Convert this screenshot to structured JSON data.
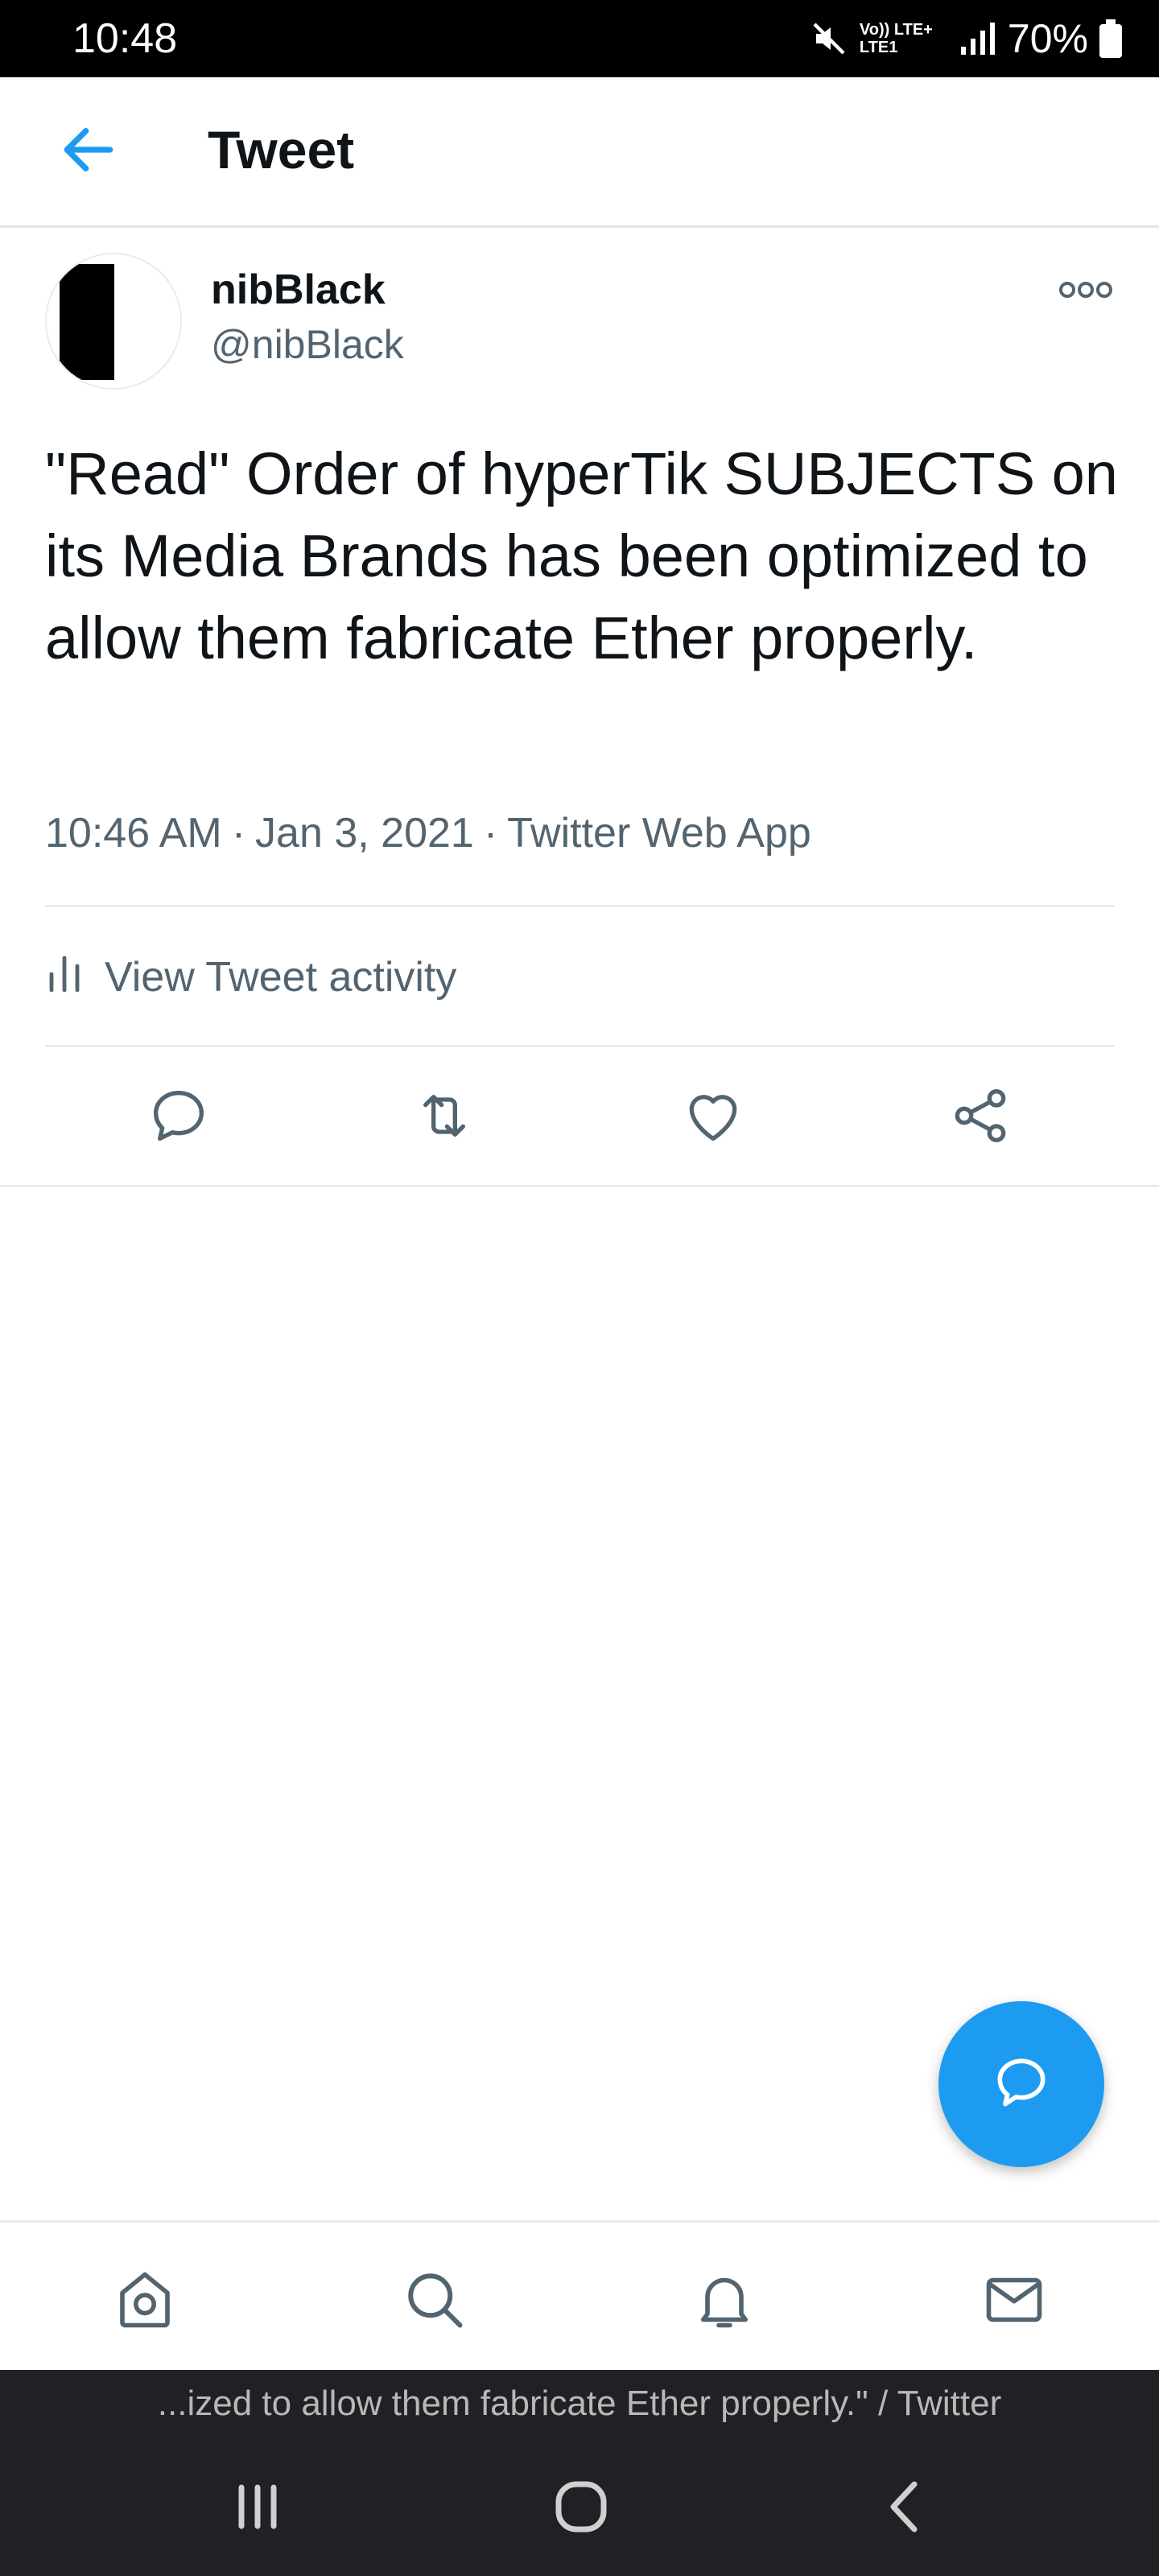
{
  "status_bar": {
    "time": "10:48",
    "network_label": "Vo)) LTE+ LTE1",
    "battery_percent": "70%",
    "icons": [
      "mute-icon",
      "signal-icon",
      "battery-icon"
    ]
  },
  "header": {
    "back_icon": "back-arrow-icon",
    "title": "Tweet"
  },
  "tweet": {
    "author": {
      "display_name": "nibBlack",
      "handle": "@nibBlack"
    },
    "more_icon": "more-options-icon",
    "text": "\"Read\" Order of hyperTik SUBJECTS on its Media Brands has been optimized to allow them fabricate Ether properly.",
    "time": "10:46 AM",
    "date": "Jan 3, 2021",
    "source": "Twitter Web App",
    "activity_label": "View Tweet activity",
    "actions": [
      "reply-icon",
      "retweet-icon",
      "like-icon",
      "share-icon"
    ]
  },
  "fab": {
    "icon": "compose-reply-icon"
  },
  "bottom_nav": {
    "items": [
      "home-icon",
      "search-icon",
      "notifications-icon",
      "messages-icon"
    ]
  },
  "system": {
    "caption": "...ized to allow them fabricate Ether properly.\" / Twitter",
    "nav_buttons": [
      "recents-icon",
      "home-circle-icon",
      "back-chevron-icon"
    ]
  },
  "colors": {
    "accent": "#1d9bf0",
    "text_primary": "#0f1419",
    "text_secondary": "#536471",
    "divider": "#e6ecf0",
    "status_bar_bg": "#000000",
    "system_bar_bg": "#202124"
  }
}
